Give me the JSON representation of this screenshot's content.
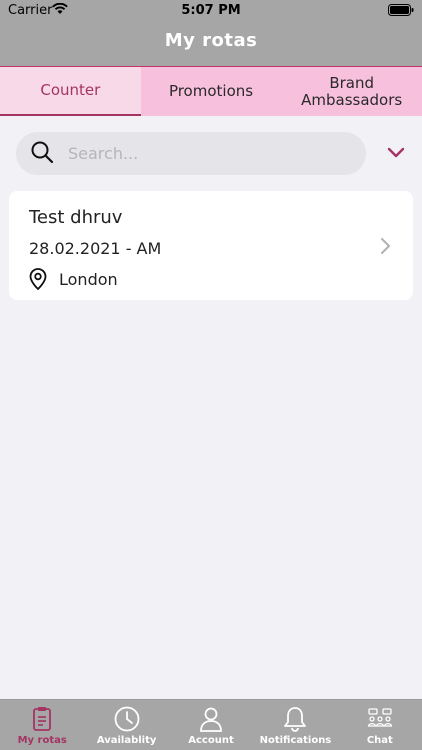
{
  "status_bar": {
    "carrier": "Carrier",
    "time": "5:07 PM"
  },
  "nav": {
    "title": "My rotas"
  },
  "tabs": [
    {
      "label": "Counter",
      "active": true
    },
    {
      "label": "Promotions",
      "active": false
    },
    {
      "label": "Brand Ambassadors",
      "active": false
    }
  ],
  "search": {
    "placeholder": "Search...",
    "value": ""
  },
  "rota": {
    "name": "Test dhruv",
    "date": "28.02.2021 - AM",
    "location": "London"
  },
  "tabbar": [
    {
      "label": "My rotas",
      "icon": "clipboard-icon",
      "active": true
    },
    {
      "label": "Availablity",
      "icon": "clock-icon",
      "active": false
    },
    {
      "label": "Account",
      "icon": "person-icon",
      "active": false
    },
    {
      "label": "Notifications",
      "icon": "bell-icon",
      "active": false
    },
    {
      "label": "Chat",
      "icon": "group-chat-icon",
      "active": false
    }
  ],
  "colors": {
    "accent": "#a43463",
    "header": "#a6a6a6",
    "tab_bg": "#f7c0dc",
    "tab_active_bg": "#f8d9e8"
  }
}
